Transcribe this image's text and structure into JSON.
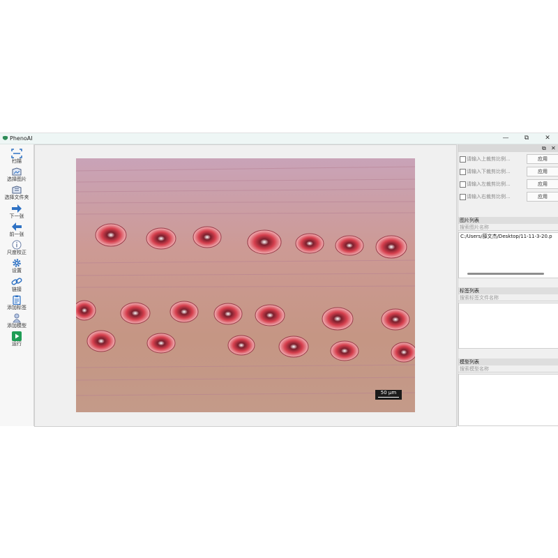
{
  "app": {
    "title": "PhenoAI",
    "brand_color": "#2e8b57"
  },
  "window_controls": {
    "minimize": "—",
    "restore": "⧉",
    "close": "✕"
  },
  "toolbar": {
    "items": [
      {
        "label": "扫描",
        "icon": "scan-icon"
      },
      {
        "label": "选择图片",
        "icon": "image-folder-icon"
      },
      {
        "label": "选择文件夹",
        "icon": "folder-icon"
      },
      {
        "label": "下一张",
        "icon": "arrow-right-icon"
      },
      {
        "label": "前一张",
        "icon": "arrow-left-icon"
      },
      {
        "label": "尺度校正",
        "icon": "info-icon"
      },
      {
        "label": "设置",
        "icon": "gear-icon"
      },
      {
        "label": "链接",
        "icon": "link-icon"
      },
      {
        "label": "添加标签",
        "icon": "clipboard-icon"
      },
      {
        "label": "添加模型",
        "icon": "model-icon"
      },
      {
        "label": "运行",
        "icon": "play-icon"
      }
    ]
  },
  "viewer": {
    "scale_label": "50 µm"
  },
  "dock": {
    "restore_icon": "⧉",
    "close_icon": "✕"
  },
  "crop": {
    "rows": [
      {
        "placeholder": "请输入上裁剪比例...",
        "apply": "应用"
      },
      {
        "placeholder": "请输入下裁剪比例...",
        "apply": "应用"
      },
      {
        "placeholder": "请输入左裁剪比例...",
        "apply": "应用"
      },
      {
        "placeholder": "请输入右裁剪比例...",
        "apply": "应用"
      }
    ]
  },
  "image_list": {
    "title": "图片列表",
    "search_placeholder": "搜索图片名称",
    "items": [
      "C:/Users/薛文杰/Desktop/11-11-3-20.p"
    ]
  },
  "label_list": {
    "title": "标签列表",
    "search_placeholder": "搜索标签文件名称"
  },
  "model_list": {
    "title": "模型列表",
    "search_placeholder": "搜索模型名称"
  }
}
